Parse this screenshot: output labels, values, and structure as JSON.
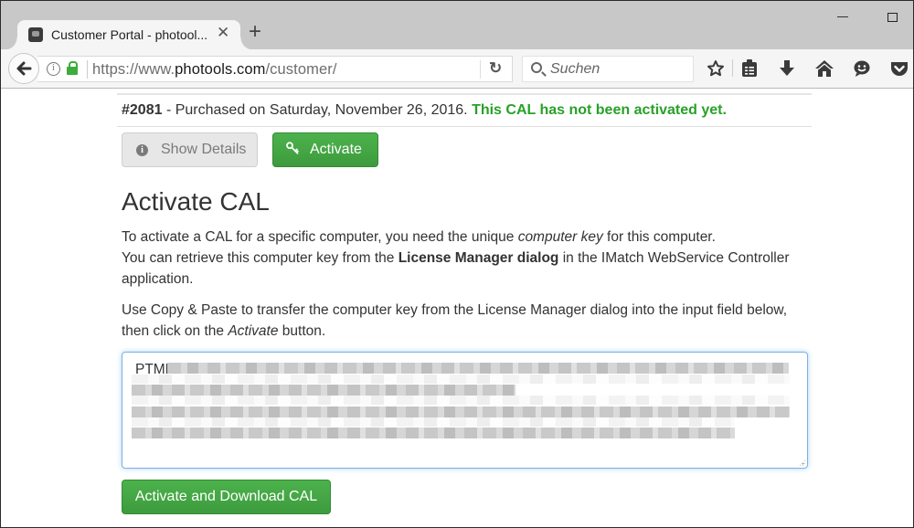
{
  "browser": {
    "tab": {
      "title": "Customer Portal - photool...",
      "close_icon": "close-icon"
    },
    "new_tab_label": "+",
    "url": {
      "prefix": "https://www.",
      "domain": "photools.com",
      "path": "/customer/"
    },
    "search_placeholder": "Suchen",
    "toolbar_icons": [
      "bookmark-star-icon",
      "reading-list-icon",
      "downloads-icon",
      "home-icon",
      "hello-icon",
      "pocket-icon"
    ]
  },
  "page": {
    "order_number": "#2081",
    "purchase_text": " - Purchased on Saturday, November 26, 2016. ",
    "status_text": "This CAL has not been activated yet.",
    "status_color": "#27a127",
    "buttons": {
      "show_details": "Show Details",
      "activate": "Activate",
      "activate_download": "Activate and Download CAL"
    },
    "heading": "Activate CAL",
    "para1": {
      "a": "To activate a CAL for a specific computer, you need the unique ",
      "em": "computer key",
      "b": " for this computer.",
      "c": "You can retrieve this computer key from the ",
      "strong": "License Manager dialog",
      "d": " in the IMatch WebService Controller application."
    },
    "para2": {
      "a": "Use Copy & Paste to transfer the computer key from the License Manager dialog into the input field below, then click on the ",
      "em": "Activate",
      "b": " button."
    },
    "computer_key": {
      "visible_prefix": "PTMK",
      "redacted": true
    }
  }
}
